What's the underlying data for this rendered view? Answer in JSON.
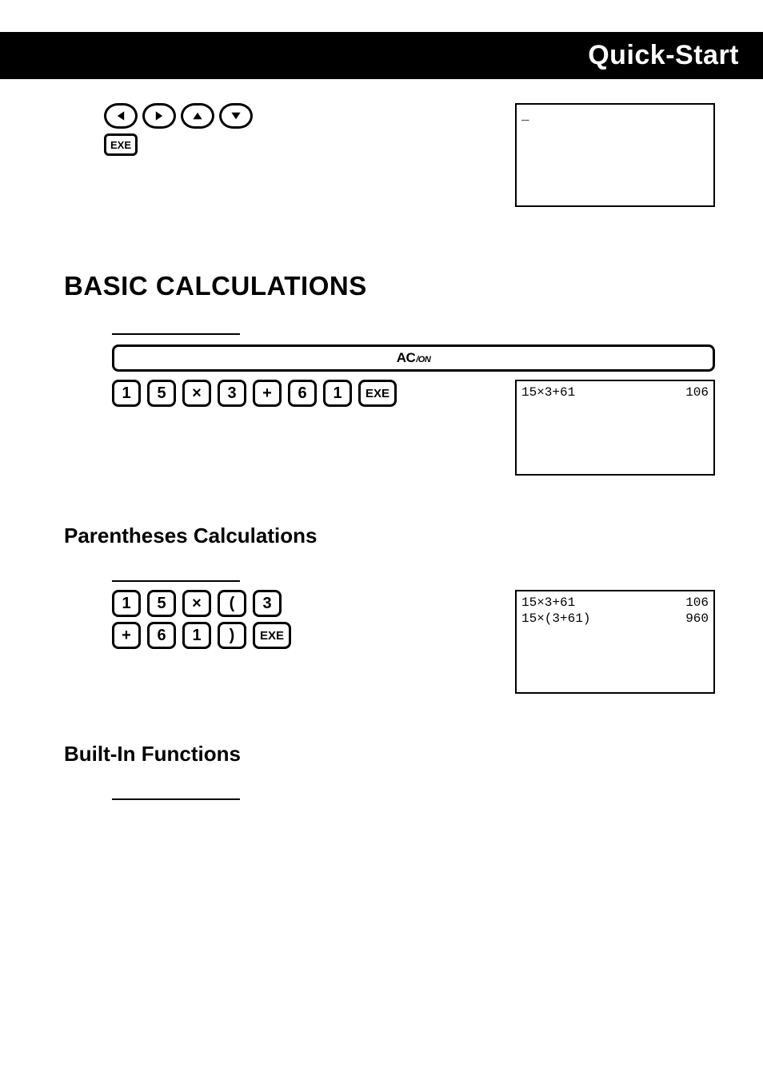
{
  "header": {
    "title": "Quick-Start"
  },
  "cursor_block": {
    "exe": "EXE"
  },
  "lcd_top": {
    "line1_left": "_"
  },
  "section_basic": {
    "title": "BASIC CALCULATIONS"
  },
  "op_acon": {
    "ac": "AC",
    "on": "/ON"
  },
  "op_basic_keys": [
    "1",
    "5",
    "×",
    "3",
    "+",
    "6",
    "1",
    "EXE"
  ],
  "lcd_basic": {
    "r1_left": "15×3+61",
    "r1_right": "106"
  },
  "section_paren": {
    "title": "Parentheses Calculations"
  },
  "op_paren_keys_line1": [
    "1",
    "5",
    "×",
    "(",
    "3"
  ],
  "op_paren_keys_line2": [
    "+",
    "6",
    "1",
    ")",
    "EXE"
  ],
  "lcd_paren": {
    "r1_left": "15×3+61",
    "r1_right": "106",
    "r2_left": "15×(3+61)",
    "r2_right": "960"
  },
  "section_builtin": {
    "title": "Built-In Functions"
  }
}
